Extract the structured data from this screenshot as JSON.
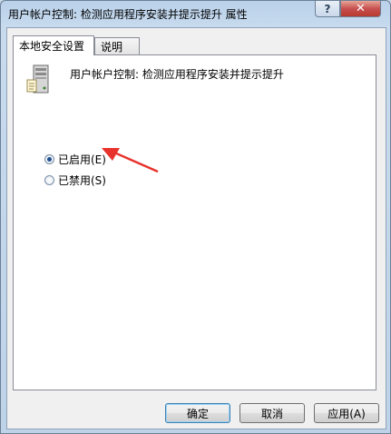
{
  "window": {
    "title": "用户帐户控制: 检测应用程序安装并提示提升 属性",
    "help_label": "?",
    "close_label": "✕"
  },
  "tabs": [
    {
      "label": "本地安全设置",
      "active": true
    },
    {
      "label": "说明",
      "active": false
    }
  ],
  "policy": {
    "title": "用户帐户控制: 检测应用程序安装并提示提升",
    "icon": "server-policy-icon"
  },
  "options": [
    {
      "label": "已启用(E)",
      "checked": true
    },
    {
      "label": "已禁用(S)",
      "checked": false
    }
  ],
  "buttons": {
    "ok": "确定",
    "cancel": "取消",
    "apply": "应用(A)"
  },
  "annotation": {
    "color": "#e8322c"
  }
}
